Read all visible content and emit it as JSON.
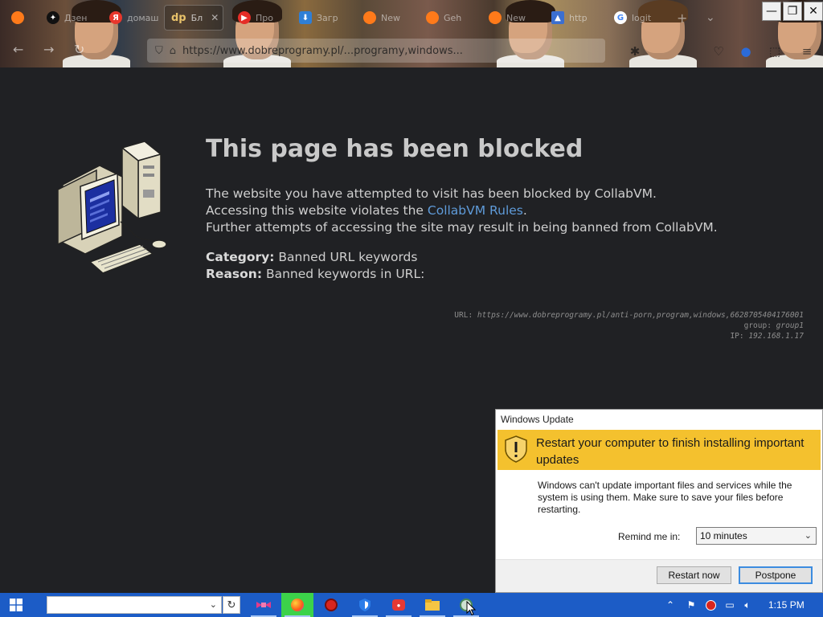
{
  "browser": {
    "tabs": [
      {
        "label": "",
        "icon": "firefox-icon"
      },
      {
        "label": "Дзен",
        "icon": "dzen-icon"
      },
      {
        "label": "домашняя",
        "icon": "yandex-icon"
      },
      {
        "label": "Бл",
        "icon": "dp-icon",
        "icon_text": "dp",
        "active": true
      },
      {
        "label": "Про",
        "icon": "youtube-icon"
      },
      {
        "label": "Загр",
        "icon": "download-icon"
      },
      {
        "label": "New",
        "icon": "firefox-icon"
      },
      {
        "label": "Geh",
        "icon": "firefox-icon"
      },
      {
        "label": "New",
        "icon": "firefox-icon"
      },
      {
        "label": "http",
        "icon": "graduation-icon"
      },
      {
        "label": "logit",
        "icon": "google-icon",
        "icon_text": "G"
      }
    ],
    "new_tab_glyph": "+",
    "tab_list_glyph": "⌄",
    "tab_close_glyph": "✕",
    "url": "https://www.dobreprogramy.pl/...programy,windows...",
    "url_prefix": "h",
    "window_controls": {
      "minimize": "—",
      "restore": "❐",
      "close": "✕"
    }
  },
  "blocked_page": {
    "title": "This page has been blocked",
    "line1": "The website you have attempted to visit has been blocked by CollabVM.",
    "line2_prefix": "Accessing this website violates the ",
    "line2_link": "CollabVM Rules",
    "line2_suffix": ".",
    "line3": "Further attempts of accessing the site may result in being banned from CollabVM.",
    "category_label": "Category:",
    "category_value": "Banned URL keywords",
    "reason_label": "Reason:",
    "reason_value": "Banned keywords in URL:",
    "details": {
      "url_label": "URL:",
      "url_value": "https://www.dobreprogramy.pl/anti-porn,program,windows,6628705404176001",
      "group_label": "group:",
      "group_value": "group1",
      "ip_label": "IP:",
      "ip_value": "192.168.1.17"
    },
    "link_color": "#5f9bd9"
  },
  "windows_update": {
    "window_title": "Windows Update",
    "heading": "Restart your computer to finish installing important updates",
    "body": "Windows can't update important files and services while the system is using them. Make sure to save your files before restarting.",
    "remind_label": "Remind me in:",
    "remind_selected": "10 minutes",
    "restart_button": "Restart now",
    "postpone_button": "Postpone",
    "banner_color": "#f4c12e"
  },
  "taskbar": {
    "clock": "1:15 PM",
    "apps": [
      "ribbon-app-icon",
      "firefox-icon",
      "app-red-icon",
      "shield-app-icon",
      "video-app-icon",
      "file-explorer-icon",
      "windows-update-icon"
    ],
    "tray": [
      "chevron-up-icon",
      "flag-icon",
      "antivirus-icon",
      "network-icon",
      "volume-muted-icon"
    ],
    "color": "#1c5cc6"
  }
}
